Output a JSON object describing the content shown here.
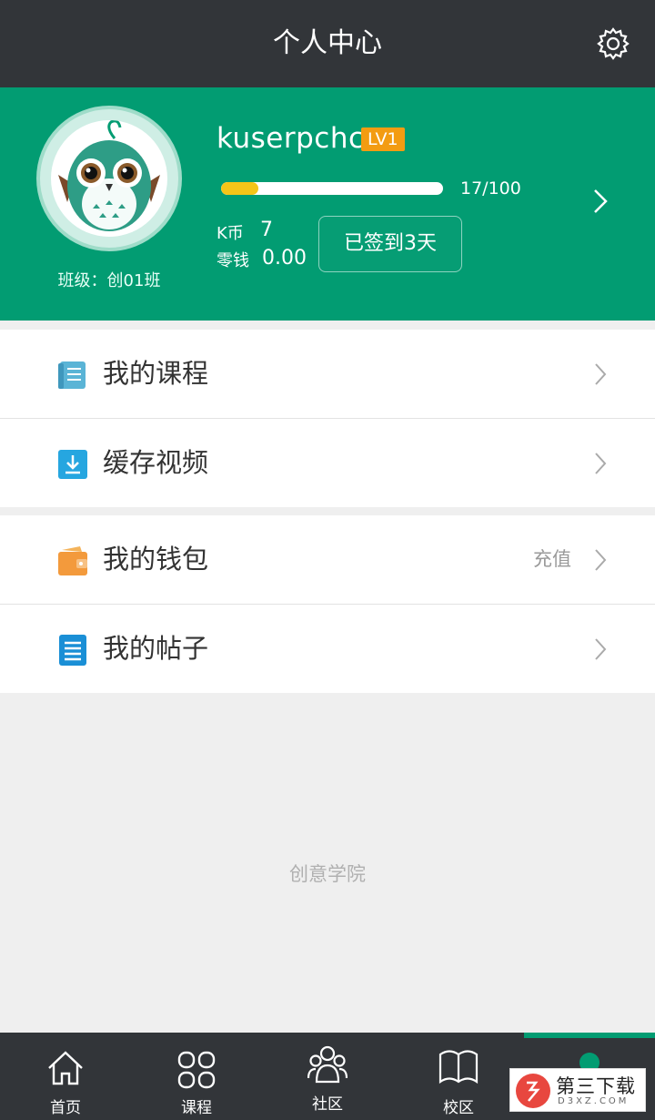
{
  "header": {
    "title": "个人中心",
    "settings_icon": "gear-icon"
  },
  "profile": {
    "username": "kuserpchc",
    "level": "LV1",
    "progress_text": "17/100",
    "progress_fraction": 0.17,
    "class_label": "班级：创01班",
    "kbi_label": "K币",
    "kbi_value": "7",
    "change_label": "零钱",
    "change_value": "0.00",
    "checkin_label": "已签到3天",
    "accent_color": "#029c72",
    "level_color": "#f39c12"
  },
  "menu": {
    "group1": [
      {
        "label": "我的课程",
        "icon": "course-book-icon"
      },
      {
        "label": "缓存视频",
        "icon": "download-icon"
      }
    ],
    "group2": [
      {
        "label": "我的钱包",
        "icon": "wallet-icon",
        "extra": "充值"
      },
      {
        "label": "我的帖子",
        "icon": "post-document-icon"
      }
    ]
  },
  "footer_brand": "创意学院",
  "bottom_nav": [
    {
      "label": "首页",
      "icon": "home-icon"
    },
    {
      "label": "课程",
      "icon": "grid-icon"
    },
    {
      "label": "社区",
      "icon": "community-icon"
    },
    {
      "label": "校区",
      "icon": "campus-book-icon"
    },
    {
      "label": "",
      "icon": "profile-dot-icon",
      "active": true
    }
  ],
  "watermark": {
    "title": "第三下载",
    "subtitle": "D3XZ.COM"
  }
}
